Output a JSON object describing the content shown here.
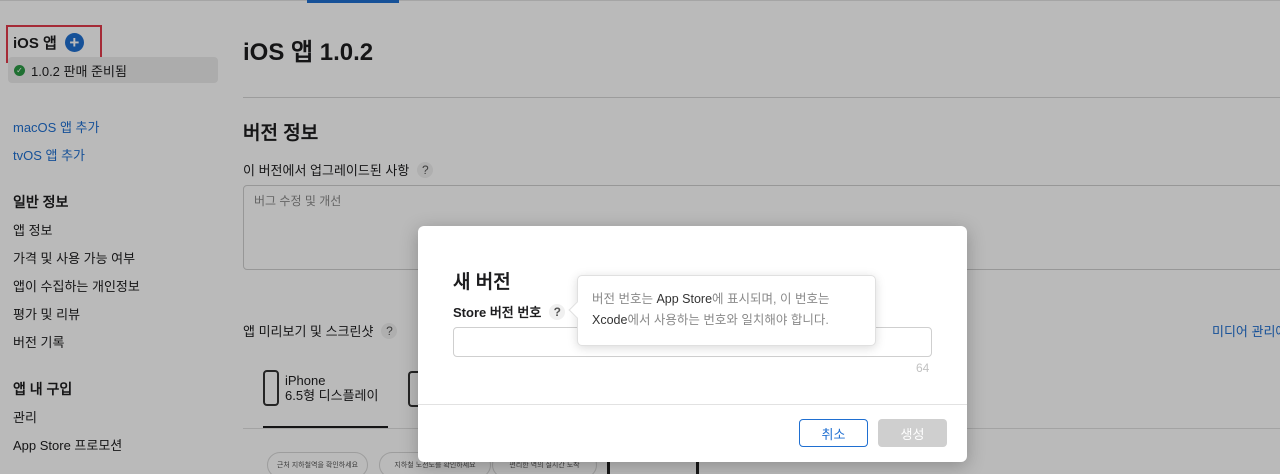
{
  "sidebar": {
    "app_title": "iOS 앱",
    "add_icon": "plus-circle-icon",
    "version_status": "1.0.2 판매 준비됨",
    "add_macos": "macOS 앱 추가",
    "add_tvos": "tvOS 앱 추가",
    "general_heading": "일반 정보",
    "general_items": [
      "앱 정보",
      "가격 및 사용 가능 여부",
      "앱이 수집하는 개인정보",
      "평가 및 리뷰",
      "버전 기록"
    ],
    "iap_heading": "앱 내 구입",
    "iap_items": [
      "관리",
      "App Store 프로모션"
    ]
  },
  "main": {
    "title": "iOS 앱 1.0.2",
    "section_title": "버전 정보",
    "whats_new_label": "이 버전에서 업그레이드된 사항",
    "whats_new_value": "버그 수정 및 개선",
    "preview_label": "앱 미리보기 및 스크린샷",
    "media_link": "미디어 관리에",
    "device_line1": "iPhone",
    "device_line2": "6.5형 디스플레이",
    "chips": [
      "근처 지하철역을 확인하세요",
      "지하철 노선도를 확인하세요",
      "편리한 역의 실시간 도착"
    ],
    "help_mark": "?"
  },
  "modal": {
    "title": "새 버전",
    "field_label": "Store 버전 번호",
    "input_value": "",
    "char_limit": "64",
    "cancel_label": "취소",
    "create_label": "생성"
  },
  "tooltip": {
    "part1": "버전 번호는 ",
    "part2": "App Store",
    "part3": "에 표시되며, 이 번호는 ",
    "part4": "Xcode",
    "part5": "에서 사용하는 번호와 일치해야 합니다."
  },
  "colors": {
    "accent": "#1f6fd1",
    "highlight": "#e23a4a",
    "status_ok": "#2b9a45"
  }
}
